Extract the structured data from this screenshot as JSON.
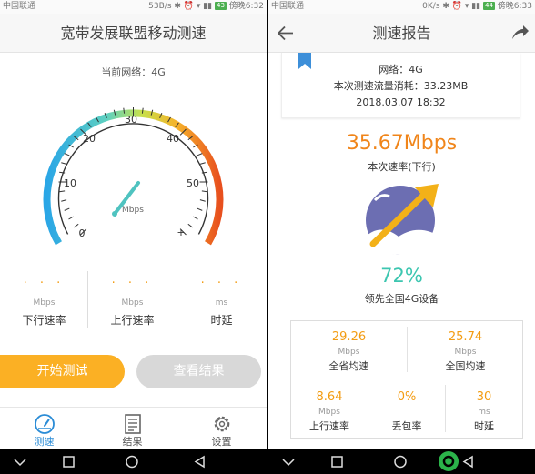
{
  "left": {
    "status": {
      "carrier": "中国联通",
      "right": "53B/s ✱ ⏰ ▾ ▮▮ ",
      "battery": "43",
      "time": "傍晚6:32"
    },
    "title": "宽带发展联盟移动测速",
    "current_network": "当前网络：4G",
    "gauge": {
      "ticks": [
        "0",
        "10",
        "20",
        "30",
        "40",
        "50",
        "+"
      ],
      "unit": "Mbps"
    },
    "stats": [
      {
        "value": "· · ·",
        "unit": "Mbps",
        "label": "下行速率"
      },
      {
        "value": "· · ·",
        "unit": "Mbps",
        "label": "上行速率"
      },
      {
        "value": "· · ·",
        "unit": "ms",
        "label": "时延"
      }
    ],
    "buttons": {
      "start": "开始测试",
      "view": "查看结果"
    },
    "tabs": [
      {
        "label": "测速",
        "icon": "speedometer-icon",
        "active": true
      },
      {
        "label": "结果",
        "icon": "list-icon",
        "active": false
      },
      {
        "label": "设置",
        "icon": "gear-icon",
        "active": false
      }
    ],
    "colors": {
      "accent": "#2b8cd6",
      "orange": "#f39c12",
      "button": "#fbb024",
      "button_disabled": "#d8d8d8"
    }
  },
  "right": {
    "status": {
      "carrier": "中国联通",
      "right": "0K/s ✱ ⏰ ▾ ▮▮ ",
      "battery": "44",
      "time": "傍晚6:33"
    },
    "title": "测速报告",
    "report": {
      "network": "网络：4G",
      "data_used": "本次测速流量消耗：33.23MB",
      "datetime": "2018.03.07  18:32"
    },
    "speed": {
      "value": "35.67Mbps",
      "label": "本次速率(下行)"
    },
    "percent": {
      "value": "72%",
      "label": "领先全国4G设备"
    },
    "grid": {
      "row1": [
        {
          "value": "29.26",
          "unit": "Mbps",
          "label": "全省均速"
        },
        {
          "value": "25.74",
          "unit": "Mbps",
          "label": "全国均速"
        }
      ],
      "row2": [
        {
          "value": "8.64",
          "unit": "Mbps",
          "label": "上行速率"
        },
        {
          "value": "0%",
          "unit": "",
          "label": "丢包率"
        },
        {
          "value": "30",
          "unit": "ms",
          "label": "时延"
        }
      ]
    },
    "colors": {
      "speed": "#f0851a",
      "percent": "#3cc6b0"
    }
  }
}
